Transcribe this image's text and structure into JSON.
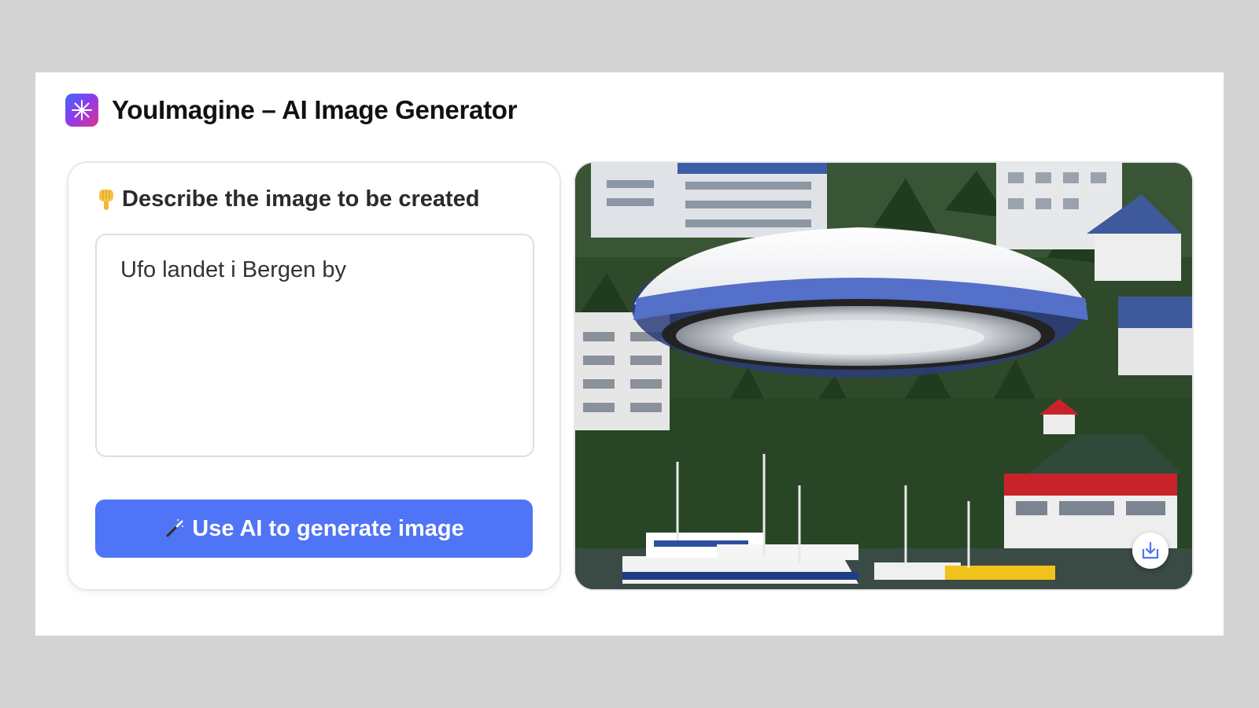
{
  "app": {
    "title": "YouImagine – AI Image Generator",
    "logo_icon": "sparkle-icon"
  },
  "prompt": {
    "label": "Describe the image to be created",
    "label_icon": "pointing-down-hand-icon",
    "value": "Ufo landet i Bergen by"
  },
  "generate_button": {
    "label": "Use AI to generate image",
    "icon": "magic-wand-icon",
    "color": "#4f74f5"
  },
  "result": {
    "description_icon": "generated-image",
    "download_icon": "download-icon"
  }
}
